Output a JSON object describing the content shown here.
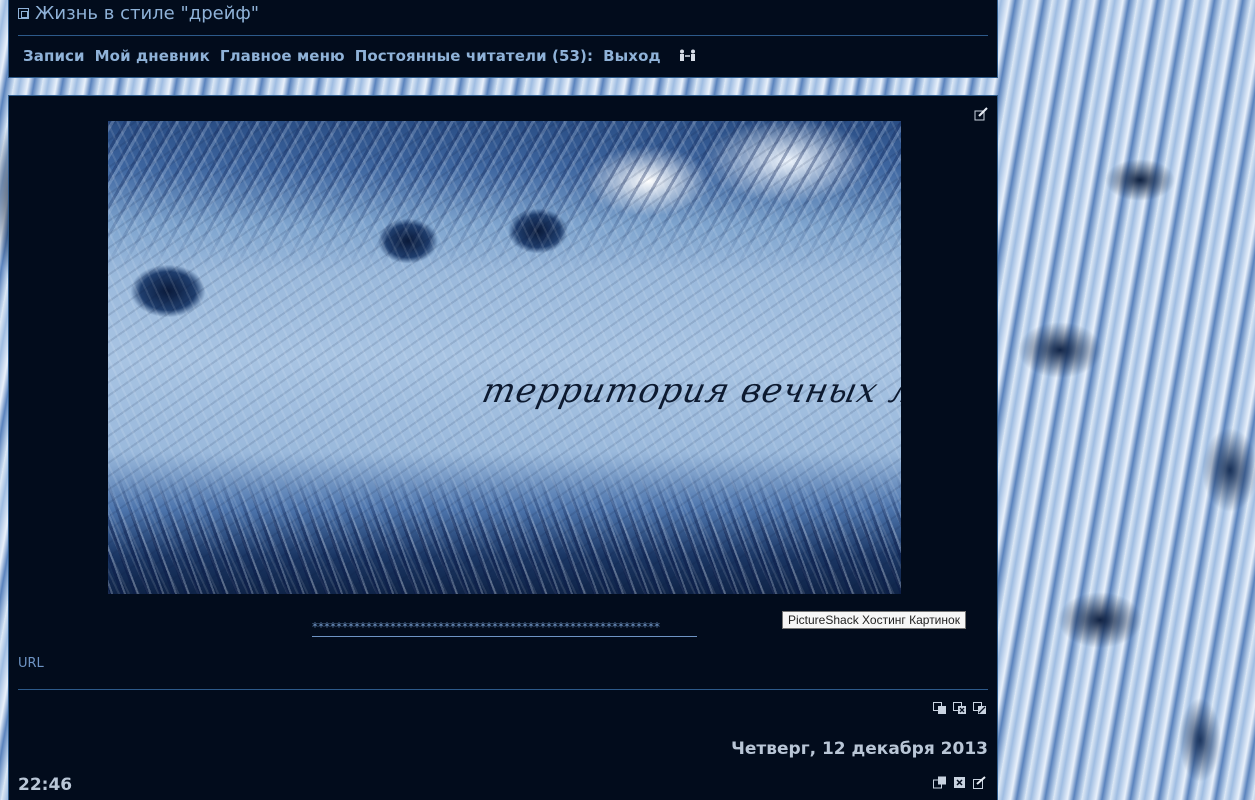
{
  "header": {
    "title": "Жизнь в стиле \"дрейф\"",
    "nav": [
      {
        "label": "Записи"
      },
      {
        "label": "Мой дневник"
      },
      {
        "label": "Главное меню"
      },
      {
        "label": "Постоянные читатели (53):"
      },
      {
        "label": "Выход"
      }
    ]
  },
  "post": {
    "banner_text": "территория вечных льдов",
    "separator": "**********************************************************",
    "tooltip": "PictureShack Хостинг Картинок",
    "url_label": "URL"
  },
  "entry": {
    "date": "Четверг, 12 декабря 2013",
    "time": "22:46"
  },
  "icons": {
    "title": "diary-icon",
    "people": "readers-icon",
    "edit": "edit-pencil-icon",
    "post_tools": [
      "copy-icon",
      "delete-icon",
      "edit-icon"
    ],
    "entry_tools": [
      "copy-icon",
      "delete-icon",
      "edit-icon"
    ]
  },
  "colors": {
    "panel_bg": "#020c1c",
    "border": "#2d5a8a",
    "link": "#8fb2d8",
    "text": "#b9c6d6"
  }
}
